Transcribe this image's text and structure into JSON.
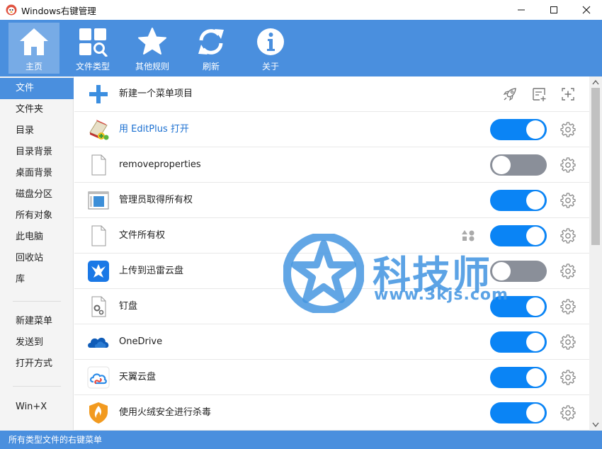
{
  "window": {
    "title": "Windows右键管理",
    "controls": [
      "minimize-icon",
      "maximize-icon",
      "close-icon"
    ]
  },
  "colors": {
    "accent": "#4a8fde",
    "toggle_on": "#0a84f5",
    "toggle_off": "#8a8f99",
    "link": "#1a6fd1"
  },
  "toolbar": [
    {
      "label": "主页",
      "icon": "home-icon",
      "active": true
    },
    {
      "label": "文件类型",
      "icon": "file-types-icon",
      "active": false
    },
    {
      "label": "其他规则",
      "icon": "star-icon",
      "active": false
    },
    {
      "label": "刷新",
      "icon": "refresh-icon",
      "active": false
    },
    {
      "label": "关于",
      "icon": "info-icon",
      "active": false
    }
  ],
  "sidebar": {
    "groups": [
      [
        {
          "label": "文件",
          "active": true
        },
        {
          "label": "文件夹"
        },
        {
          "label": "目录"
        },
        {
          "label": "目录背景"
        },
        {
          "label": "桌面背景"
        },
        {
          "label": "磁盘分区"
        },
        {
          "label": "所有对象"
        },
        {
          "label": "此电脑"
        },
        {
          "label": "回收站"
        },
        {
          "label": "库"
        }
      ],
      [
        {
          "label": "新建菜单"
        },
        {
          "label": "发送到"
        },
        {
          "label": "打开方式"
        }
      ],
      [
        {
          "label": "Win+X"
        }
      ]
    ]
  },
  "list": {
    "new_item": {
      "label": "新建一个菜单项目",
      "icon": "plus-icon",
      "actions": [
        "rocket-icon",
        "add-list-icon",
        "add-item-icon"
      ]
    },
    "items": [
      {
        "label": "用 EditPlus 打开",
        "icon": "editplus-icon",
        "enabled": true,
        "link": true
      },
      {
        "label": "removeproperties",
        "icon": "blank-file-icon",
        "enabled": false
      },
      {
        "label": "管理员取得所有权",
        "icon": "window-app-icon",
        "enabled": true
      },
      {
        "label": "文件所有权",
        "icon": "blank-file-icon",
        "enabled": true,
        "badge": "shapes-icon"
      },
      {
        "label": "上传到迅雷云盘",
        "icon": "thunder-bird-icon",
        "enabled": false
      },
      {
        "label": "钉盘",
        "icon": "gear-file-icon",
        "enabled": true
      },
      {
        "label": "OneDrive",
        "icon": "onedrive-cloud-icon",
        "enabled": true
      },
      {
        "label": "天翼云盘",
        "icon": "tianyi-cloud-icon",
        "enabled": true
      },
      {
        "label": "使用火绒安全进行杀毒",
        "icon": "huorong-shield-icon",
        "enabled": true
      }
    ]
  },
  "watermark": {
    "title": "科技师",
    "url": "www.3kjs.com"
  },
  "status": "所有类型文件的右键菜单"
}
